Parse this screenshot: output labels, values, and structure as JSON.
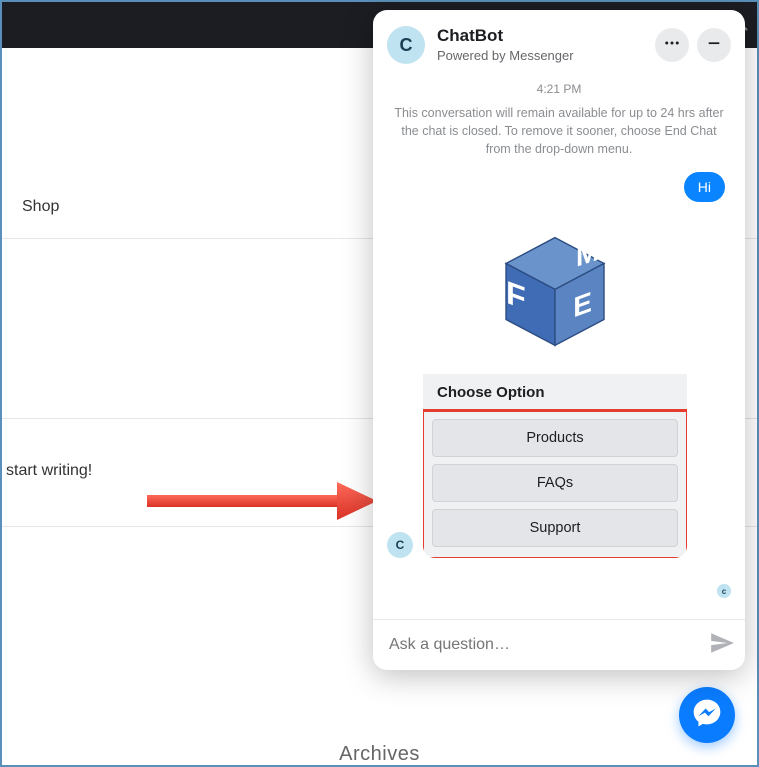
{
  "page": {
    "shop_label": "Shop",
    "start_writing": "start writing!",
    "archives": "Archives"
  },
  "chat": {
    "header": {
      "avatar_initial": "C",
      "title": "ChatBot",
      "subtitle": "Powered by Messenger"
    },
    "timestamp": "4:21 PM",
    "info": "This conversation will remain available for up to 24 hrs after the chat is closed. To remove it sooner, choose End Chat from the drop-down menu.",
    "user_message": "Hi",
    "card": {
      "title": "Choose Option",
      "options": [
        "Products",
        "FAQs",
        "Support"
      ]
    },
    "bot_avatar_initial": "C",
    "tiny_avatar_initial": "c",
    "input_placeholder": "Ask a question…"
  }
}
